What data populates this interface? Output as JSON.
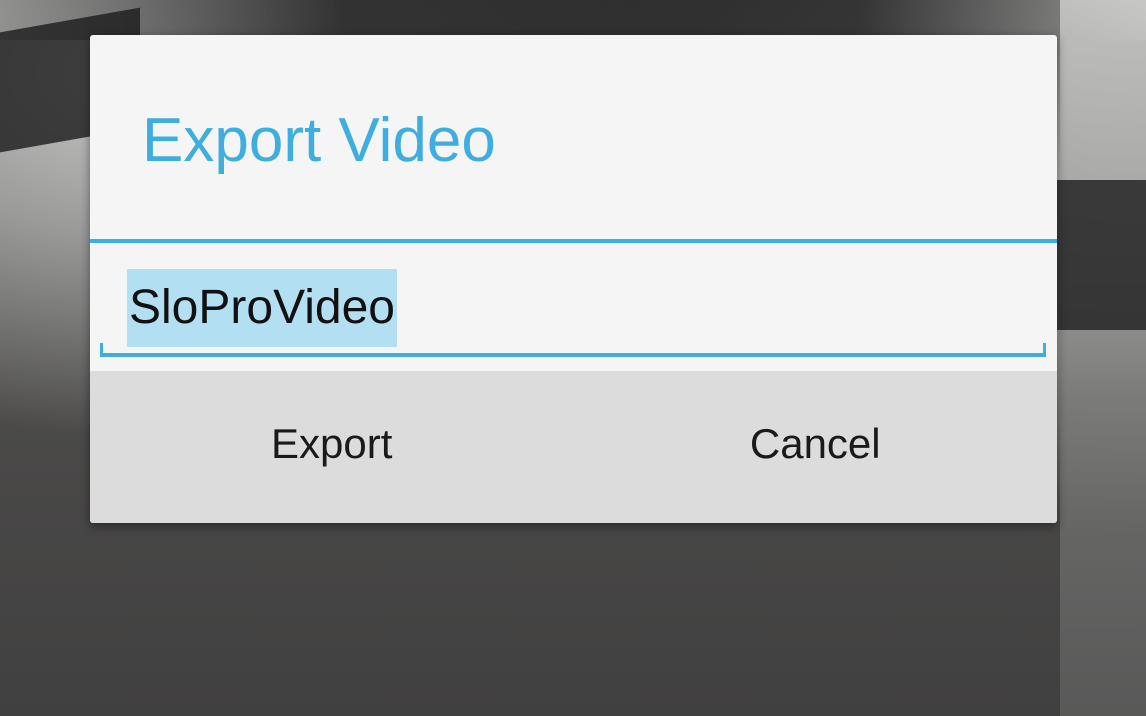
{
  "dialog": {
    "title": "Export Video",
    "filename_field": {
      "value": "SloProVideo"
    },
    "buttons": {
      "export_label": "Export",
      "cancel_label": "Cancel"
    }
  },
  "colors": {
    "accent": "#3daedf",
    "selection": "#b3dff2",
    "dialog_background": "#f5f5f5",
    "button_bar": "#dcdcdc"
  }
}
